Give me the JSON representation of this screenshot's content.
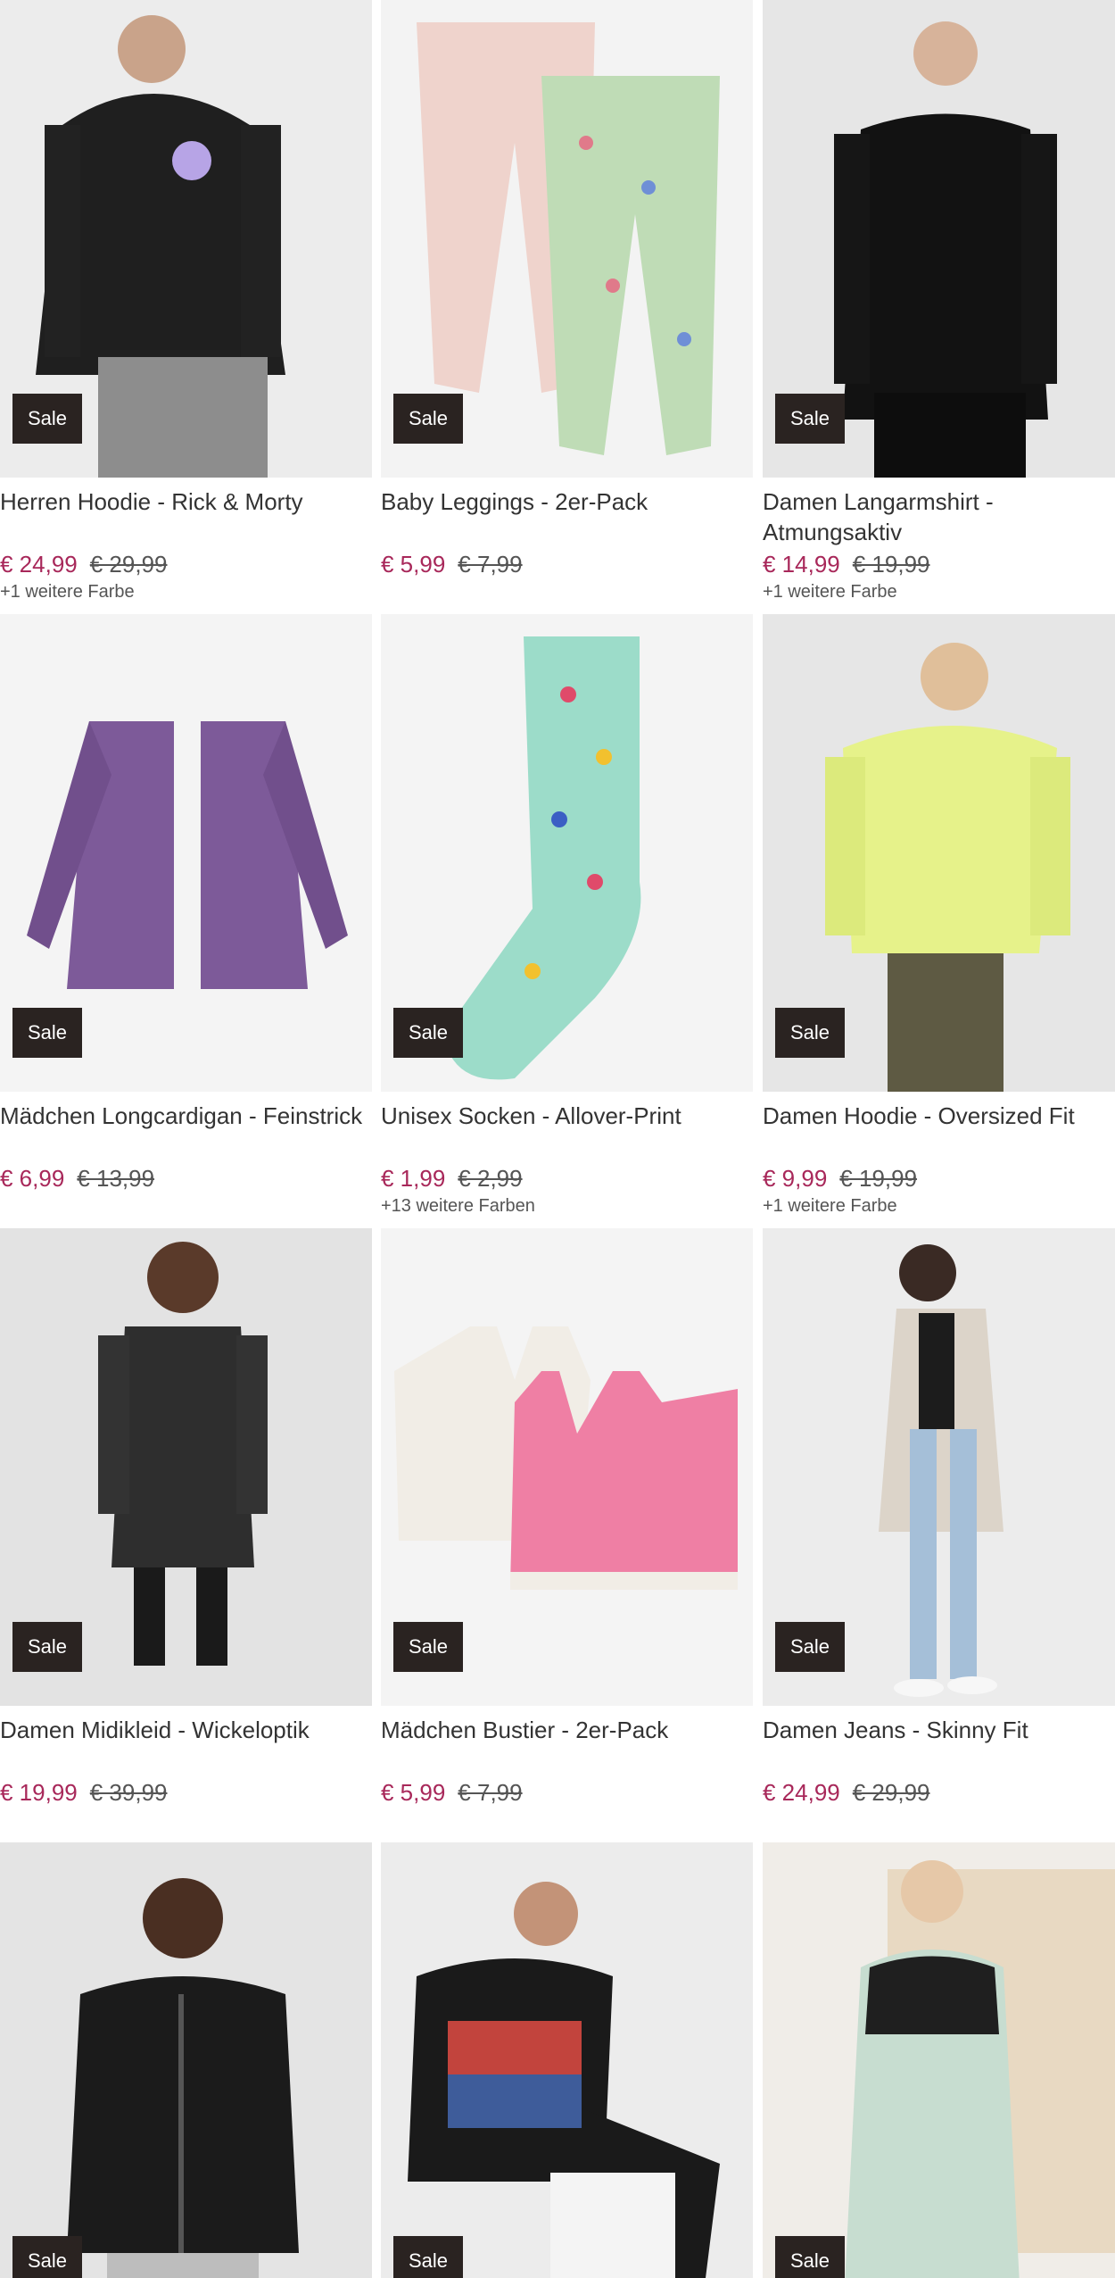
{
  "badge_label": "Sale",
  "colors": {
    "sale_price": "#a8285a",
    "badge_bg": "#2a2321"
  },
  "products": [
    {
      "title": "Herren Hoodie - Rick & Morty",
      "sale_price": "€ 24,99",
      "old_price": "€ 29,99",
      "more_colors": "+1 weitere Farbe",
      "image": "black-hoodie"
    },
    {
      "title": "Baby Leggings - 2er-Pack",
      "sale_price": "€ 5,99",
      "old_price": "€ 7,99",
      "more_colors": "",
      "image": "leggings"
    },
    {
      "title": "Damen Langarmshirt - Atmungsaktiv",
      "sale_price": "€ 14,99",
      "old_price": "€ 19,99",
      "more_colors": "+1 weitere Farbe",
      "image": "longsleeve"
    },
    {
      "title": "Mädchen Longcardigan - Feinstrick",
      "sale_price": "€ 6,99",
      "old_price": "€ 13,99",
      "more_colors": "",
      "image": "cardigan"
    },
    {
      "title": "Unisex Socken - Allover-Print",
      "sale_price": "€ 1,99",
      "old_price": "€ 2,99",
      "more_colors": "+13 weitere Farben",
      "image": "socks"
    },
    {
      "title": "Damen Hoodie - Oversized Fit",
      "sale_price": "€ 9,99",
      "old_price": "€ 19,99",
      "more_colors": "+1 weitere Farbe",
      "image": "yellow-hoodie"
    },
    {
      "title": "Damen Midikleid - Wickeloptik",
      "sale_price": "€ 19,99",
      "old_price": "€ 39,99",
      "more_colors": "",
      "image": "dress"
    },
    {
      "title": "Mädchen Bustier - 2er-Pack",
      "sale_price": "€ 5,99",
      "old_price": "€ 7,99",
      "more_colors": "",
      "image": "bustier"
    },
    {
      "title": "Damen Jeans - Skinny Fit",
      "sale_price": "€ 24,99",
      "old_price": "€ 29,99",
      "more_colors": "",
      "image": "jeans"
    },
    {
      "title": "",
      "sale_price": "",
      "old_price": "",
      "more_colors": "",
      "image": "zip-jacket"
    },
    {
      "title": "",
      "sale_price": "",
      "old_price": "",
      "more_colors": "",
      "image": "print-hoodie"
    },
    {
      "title": "",
      "sale_price": "",
      "old_price": "",
      "more_colors": "",
      "image": "puffer-coat"
    }
  ]
}
